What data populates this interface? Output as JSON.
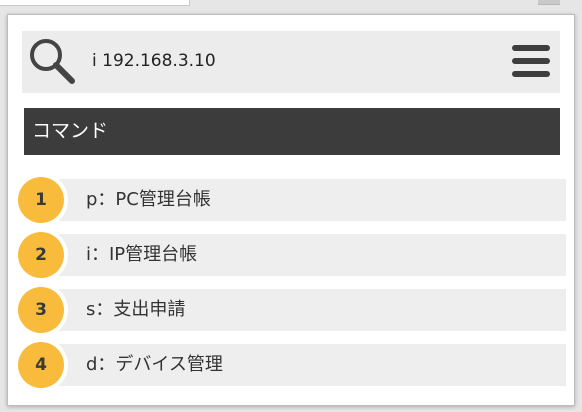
{
  "search": {
    "query": "i 192.168.3.10"
  },
  "section": {
    "title": "コマンド"
  },
  "commands": [
    {
      "number": "1",
      "label": "p：PC管理台帳"
    },
    {
      "number": "2",
      "label": "i：IP管理台帳"
    },
    {
      "number": "3",
      "label": "s：支出申請"
    },
    {
      "number": "4",
      "label": "d：デバイス管理"
    }
  ],
  "icons": {
    "search": "magnifier-icon",
    "menu": "hamburger-menu-icon"
  },
  "colors": {
    "header_bg": "#3c3c3c",
    "badge": "#f9bb3b",
    "row_bg": "#eeeeee",
    "search_bg": "#ececec"
  }
}
